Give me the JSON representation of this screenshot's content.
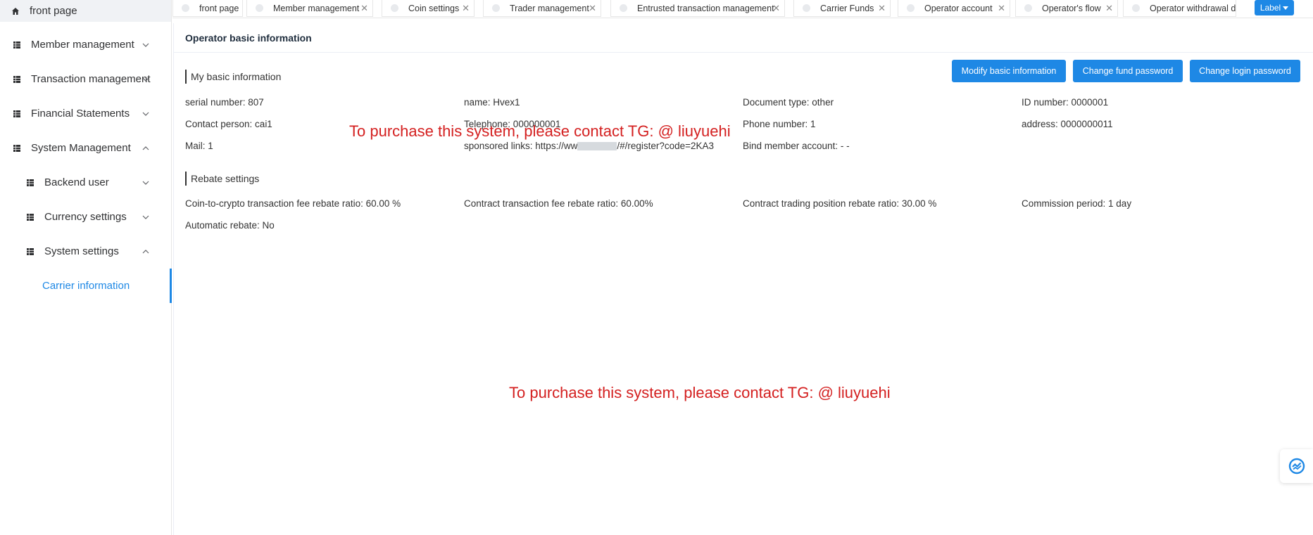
{
  "sidebar": {
    "front_page": "front page",
    "items": [
      {
        "label": "Member management"
      },
      {
        "label": "Transaction management"
      },
      {
        "label": "Financial Statements"
      },
      {
        "label": "System Management"
      }
    ],
    "sub_items": [
      {
        "label": "Backend user"
      },
      {
        "label": "Currency settings"
      },
      {
        "label": "System settings"
      }
    ],
    "active_leaf": "Carrier information"
  },
  "tabs": [
    {
      "label": "front page"
    },
    {
      "label": "Member management"
    },
    {
      "label": "Coin settings"
    },
    {
      "label": "Trader management"
    },
    {
      "label": "Entrusted transaction management"
    },
    {
      "label": "Carrier Funds"
    },
    {
      "label": "Operator account"
    },
    {
      "label": "Operator's flow"
    },
    {
      "label": "Operator withdrawal d"
    }
  ],
  "label_button": "Label",
  "card": {
    "title": "Operator basic information",
    "buttons": {
      "modify": "Modify basic information",
      "fund_pw": "Change fund password",
      "login_pw": "Change login password"
    },
    "basic_section": "My basic information",
    "basic": {
      "serial": "serial number: 807",
      "name": "name: Hvex1",
      "doc_type": "Document type: other",
      "id_number": "ID number: 0000001",
      "contact": "Contact person: cai1",
      "telephone": "Telephone: 000000001",
      "phone": "Phone number: 1",
      "address": "address: 0000000011",
      "mail": "Mail: 1",
      "links_prefix": "sponsored links: https://ww",
      "links_suffix": "/#/register?code=2KA3",
      "bind": "Bind member account: - -"
    },
    "rebate_section": "Rebate settings",
    "rebate": {
      "coin": "Coin-to-crypto transaction fee rebate ratio: 60.00 %",
      "contract_fee": "Contract transaction fee rebate ratio: 60.00%",
      "contract_pos": "Contract trading position rebate ratio: 30.00 %",
      "period": "Commission period: 1 day",
      "auto": "Automatic rebate: No"
    }
  },
  "watermarks": [
    "To purchase this system, please contact TG: @ liuyuehi",
    "To purchase this system, please contact TG: @ liuyuehi"
  ],
  "colors": {
    "accent": "#1e88e5",
    "watermark": "#d42020"
  }
}
